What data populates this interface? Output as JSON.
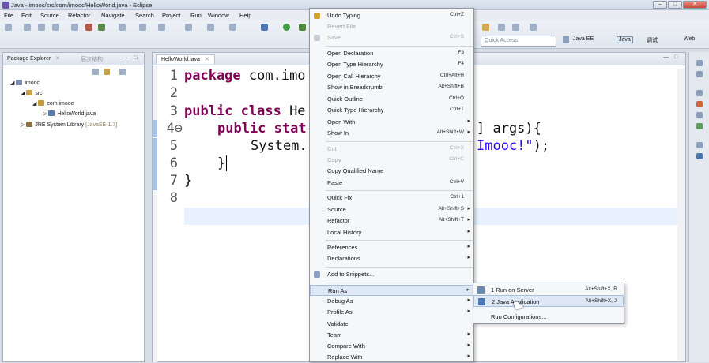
{
  "window": {
    "title": "Java - imooc/src/com/imooc/HelloWorld.java - Eclipse",
    "buttons": [
      "–",
      "□",
      "✕"
    ]
  },
  "menubar": [
    "File",
    "Edit",
    "Source",
    "Refactor",
    "Navigate",
    "Search",
    "Project",
    "Run",
    "Window",
    "Help"
  ],
  "toolbar": {
    "quick_access_placeholder": "Quick Access",
    "perspectives": [
      "Java EE",
      "Java",
      "调试",
      "Web"
    ],
    "active_perspective": "Java"
  },
  "package_explorer": {
    "tab_label": "Package Explorer",
    "tab_close": "✕",
    "second_tab": "层次结构",
    "tree": {
      "project": "imooc",
      "src": "src",
      "package": "com.imooc",
      "file": "HelloWorld.java",
      "jre_label": "JRE System Library",
      "jre_version": "[JavaSE-1.7]"
    }
  },
  "editor": {
    "tab_label": "HelloWorld.java",
    "tab_close": "✕",
    "line_numbers": [
      "1",
      "2",
      "3",
      "4⊖",
      "5",
      "6",
      "7",
      "8"
    ],
    "lines": {
      "l1_kw": "package",
      "l1_rest": " com.imo",
      "l3_kw": "public class",
      "l3_rest": " He",
      "l4_kw": "public stat",
      "l4_right": "] args){",
      "l5_left": "System.",
      "l5_str": "Imooc!\"",
      "l5_end": ");",
      "l6": "}",
      "l7": "}"
    }
  },
  "context_menu": {
    "items": [
      {
        "label": "Undo Typing",
        "shortcut": "Ctrl+Z"
      },
      {
        "label": "Revert File",
        "shortcut": "",
        "disabled": true
      },
      {
        "label": "Save",
        "shortcut": "Ctrl+S",
        "disabled": true
      },
      {
        "label": "Open Declaration",
        "shortcut": "F3"
      },
      {
        "label": "Open Type Hierarchy",
        "shortcut": "F4"
      },
      {
        "label": "Open Call Hierarchy",
        "shortcut": "Ctrl+Alt+H"
      },
      {
        "label": "Show in Breadcrumb",
        "shortcut": "Alt+Shift+B"
      },
      {
        "label": "Quick Outline",
        "shortcut": "Ctrl+O"
      },
      {
        "label": "Quick Type Hierarchy",
        "shortcut": "Ctrl+T"
      },
      {
        "label": "Open With",
        "shortcut": ""
      },
      {
        "label": "Show In",
        "shortcut": "Alt+Shift+W"
      },
      {
        "label": "Cut",
        "shortcut": "Ctrl+X",
        "disabled": true
      },
      {
        "label": "Copy",
        "shortcut": "Ctrl+C",
        "disabled": true
      },
      {
        "label": "Copy Qualified Name",
        "shortcut": ""
      },
      {
        "label": "Paste",
        "shortcut": "Ctrl+V"
      },
      {
        "label": "Quick Fix",
        "shortcut": "Ctrl+1"
      },
      {
        "label": "Source",
        "shortcut": "Alt+Shift+S"
      },
      {
        "label": "Refactor",
        "shortcut": "Alt+Shift+T"
      },
      {
        "label": "Local History",
        "shortcut": ""
      },
      {
        "label": "References",
        "shortcut": ""
      },
      {
        "label": "Declarations",
        "shortcut": ""
      },
      {
        "label": "Add to Snippets...",
        "shortcut": ""
      },
      {
        "label": "Run As",
        "shortcut": ""
      },
      {
        "label": "Debug As",
        "shortcut": ""
      },
      {
        "label": "Profile As",
        "shortcut": ""
      },
      {
        "label": "Validate",
        "shortcut": ""
      },
      {
        "label": "Team",
        "shortcut": ""
      },
      {
        "label": "Compare With",
        "shortcut": ""
      },
      {
        "label": "Replace With",
        "shortcut": ""
      }
    ],
    "submenu_arrow": "▸"
  },
  "run_as_submenu": {
    "items": [
      {
        "label": "1 Run on Server",
        "shortcut": "Alt+Shift+X, R"
      },
      {
        "label": "2 Java Application",
        "shortcut": "Alt+Shift+X, J"
      },
      {
        "label": "Run Configurations...",
        "shortcut": ""
      }
    ]
  }
}
